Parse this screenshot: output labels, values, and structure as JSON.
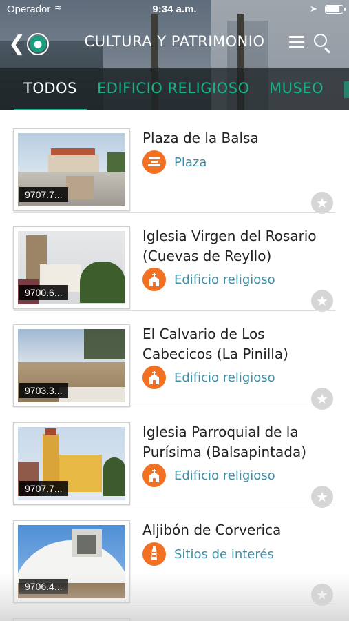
{
  "status_bar": {
    "carrier": "Operador",
    "time": "9:34 a.m.",
    "wifi_icon": "wifi-icon",
    "location_icon": "location-arrow-icon",
    "battery_icon": "battery-icon",
    "battery_level": 0.85
  },
  "nav": {
    "title": "CULTURA Y PATRIMONIO",
    "back_icon": "chevron-left-icon",
    "globe_icon": "globe-icon",
    "menu_icon": "hamburger-menu-icon",
    "search_icon": "search-icon"
  },
  "tabs": [
    {
      "label": "TODOS",
      "active": true
    },
    {
      "label": "EDIFICIO RELIGIOSO",
      "active": false
    },
    {
      "label": "MUSEO",
      "active": false
    }
  ],
  "colors": {
    "accent_green": "#19b18a",
    "category_orange": "#f27022",
    "category_text": "#3e8fa6",
    "star_grey": "#d6d6d6"
  },
  "items": [
    {
      "title": "Plaza de la Balsa",
      "code": "9707.7...",
      "category": "Plaza",
      "category_icon": "plaza-icon"
    },
    {
      "title": "Iglesia Virgen del Rosario (Cuevas de Reyllo)",
      "code": "9700.6...",
      "category": "Edificio religioso",
      "category_icon": "church-icon"
    },
    {
      "title": "El Calvario de Los Cabecicos (La Pinilla)",
      "code": "9703.3...",
      "category": "Edificio religioso",
      "category_icon": "church-icon"
    },
    {
      "title": "Iglesia Parroquial de la Purísima (Balsapintada)",
      "code": "9707.7...",
      "category": "Edificio religioso",
      "category_icon": "church-icon"
    },
    {
      "title": "Aljibón de Corverica",
      "code": "9706.4...",
      "category": "Sitios de interés",
      "category_icon": "lighthouse-icon"
    }
  ]
}
